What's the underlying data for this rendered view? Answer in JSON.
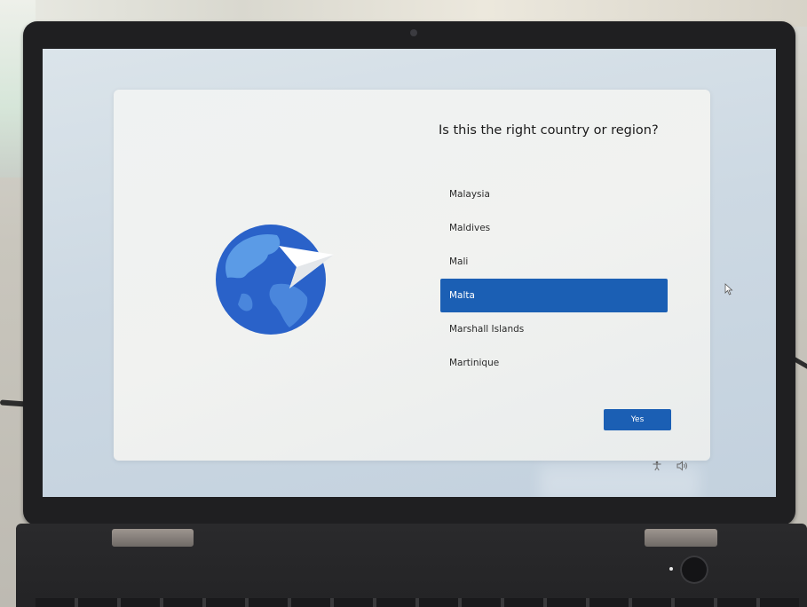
{
  "setup": {
    "question": "Is this the right country or region?",
    "countries": [
      {
        "label": "Malaysia",
        "selected": false
      },
      {
        "label": "Maldives",
        "selected": false
      },
      {
        "label": "Mali",
        "selected": false
      },
      {
        "label": "Malta",
        "selected": true
      },
      {
        "label": "Marshall Islands",
        "selected": false
      },
      {
        "label": "Martinique",
        "selected": false
      }
    ],
    "confirm_label": "Yes"
  },
  "taskbar_icons": [
    "accessibility-icon",
    "volume-icon"
  ],
  "illustration": "globe-with-paper-plane",
  "colors": {
    "accent": "#1b5fb4",
    "globe_dark": "#2a62c9",
    "globe_light": "#5b9be6"
  }
}
